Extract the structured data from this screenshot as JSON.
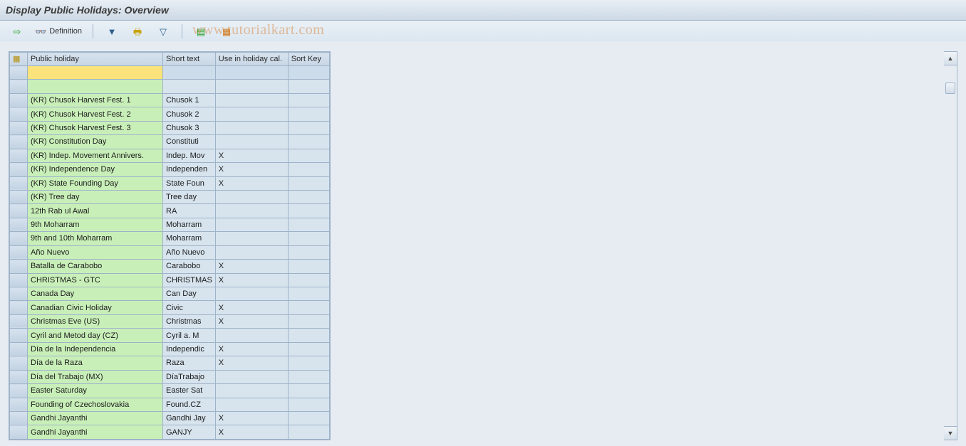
{
  "title": "Display Public Holidays: Overview",
  "watermark": "www.tutorialkart.com",
  "toolbar": {
    "execute": "",
    "definition_label": "Definition",
    "filter": "",
    "print": "",
    "sort": "",
    "export": "",
    "layout": ""
  },
  "columns": {
    "select_all": "",
    "name": "Public holiday",
    "short": "Short text",
    "use": "Use in holiday cal.",
    "sort": "Sort Key"
  },
  "rows": [
    {
      "name": "",
      "short": "",
      "use": "",
      "sort": ""
    },
    {
      "name": "",
      "short": "",
      "use": "",
      "sort": ""
    },
    {
      "name": "(KR) Chusok Harvest Fest. 1",
      "short": "Chusok 1",
      "use": "",
      "sort": ""
    },
    {
      "name": "(KR) Chusok Harvest Fest. 2",
      "short": "Chusok 2",
      "use": "",
      "sort": ""
    },
    {
      "name": "(KR) Chusok Harvest Fest. 3",
      "short": "Chusok 3",
      "use": "",
      "sort": ""
    },
    {
      "name": "(KR) Constitution Day",
      "short": "Constituti",
      "use": "",
      "sort": ""
    },
    {
      "name": "(KR) Indep. Movement Annivers.",
      "short": "Indep. Mov",
      "use": "X",
      "sort": ""
    },
    {
      "name": "(KR) Independence Day",
      "short": "Independen",
      "use": "X",
      "sort": ""
    },
    {
      "name": "(KR) State Founding Day",
      "short": "State Foun",
      "use": "X",
      "sort": ""
    },
    {
      "name": "(KR) Tree day",
      "short": "Tree day",
      "use": "",
      "sort": ""
    },
    {
      "name": "12th Rab ul Awal",
      "short": "RA",
      "use": "",
      "sort": ""
    },
    {
      "name": "9th Moharram",
      "short": "Moharram",
      "use": "",
      "sort": ""
    },
    {
      "name": "9th and 10th Moharram",
      "short": "Moharram",
      "use": "",
      "sort": ""
    },
    {
      "name": "Año Nuevo",
      "short": "Año Nuevo",
      "use": "",
      "sort": ""
    },
    {
      "name": "Batalla de Carabobo",
      "short": "Carabobo",
      "use": "X",
      "sort": ""
    },
    {
      "name": "CHRISTMAS - GTC",
      "short": "CHRISTMAS",
      "use": "X",
      "sort": ""
    },
    {
      "name": "Canada Day",
      "short": "Can Day",
      "use": "",
      "sort": ""
    },
    {
      "name": "Canadian Civic Holiday",
      "short": "Civic",
      "use": "X",
      "sort": ""
    },
    {
      "name": "Christmas Eve (US)",
      "short": "Christmas",
      "use": "X",
      "sort": ""
    },
    {
      "name": "Cyril and Metod day (CZ)",
      "short": "Cyril a. M",
      "use": "",
      "sort": ""
    },
    {
      "name": "Día de la Independencia",
      "short": "Independic",
      "use": "X",
      "sort": ""
    },
    {
      "name": "Día de la Raza",
      "short": "Raza",
      "use": "X",
      "sort": ""
    },
    {
      "name": "Día del Trabajo        (MX)",
      "short": "DíaTrabajo",
      "use": "",
      "sort": ""
    },
    {
      "name": "Easter Saturday",
      "short": "Easter Sat",
      "use": "",
      "sort": ""
    },
    {
      "name": "Founding of Czechoslovakia",
      "short": "Found.CZ",
      "use": "",
      "sort": ""
    },
    {
      "name": "Gandhi Jayanthi",
      "short": "Gandhi Jay",
      "use": "X",
      "sort": ""
    },
    {
      "name": "Gandhi Jayanthi",
      "short": "GANJY",
      "use": "X",
      "sort": ""
    }
  ]
}
